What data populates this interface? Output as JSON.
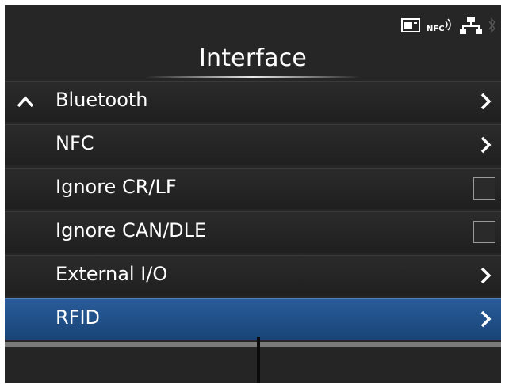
{
  "status": {
    "icons": [
      "card-icon",
      "nfc-icon",
      "network-icon",
      "bluetooth-icon"
    ],
    "nfc_text": "NFC"
  },
  "title": "Interface",
  "menu": {
    "items": [
      {
        "label": "Bluetooth",
        "kind": "submenu",
        "up_arrow": true
      },
      {
        "label": "NFC",
        "kind": "submenu"
      },
      {
        "label": "Ignore CR/LF",
        "kind": "checkbox",
        "checked": false
      },
      {
        "label": "Ignore CAN/DLE",
        "kind": "checkbox",
        "checked": false
      },
      {
        "label": "External I/O",
        "kind": "submenu"
      },
      {
        "label": "RFID",
        "kind": "submenu",
        "selected": true
      }
    ]
  },
  "colors": {
    "background": "#262626",
    "selected": "#1f4f8a",
    "text": "#ffffff"
  }
}
